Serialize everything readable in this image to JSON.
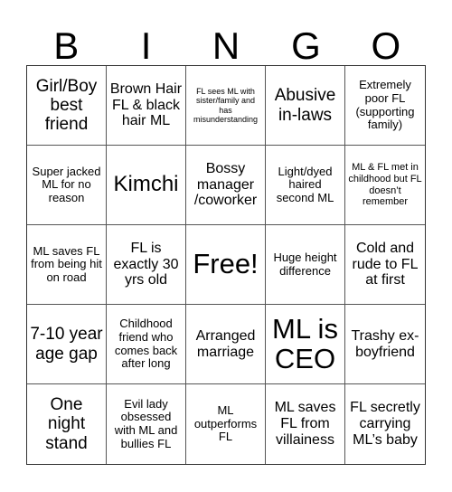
{
  "header": {
    "letters": [
      "B",
      "I",
      "N",
      "G",
      "O"
    ]
  },
  "board": {
    "rows": [
      [
        {
          "text": "Girl/Boy best friend"
        },
        {
          "text": "Brown Hair FL & black hair ML"
        },
        {
          "text": "FL sees ML with sister/family and has misunderstanding"
        },
        {
          "text": "Abusive in-laws"
        },
        {
          "text": "Extremely poor FL (supporting family)"
        }
      ],
      [
        {
          "text": "Super jacked ML for no reason"
        },
        {
          "text": "Kimchi"
        },
        {
          "text": "Bossy manager /coworker"
        },
        {
          "text": "Light/dyed haired second ML"
        },
        {
          "text": "ML & FL met in childhood but FL doesn’t remember"
        }
      ],
      [
        {
          "text": "ML saves FL from being hit on road"
        },
        {
          "text": "FL is exactly 30 yrs old"
        },
        {
          "text": "Free!"
        },
        {
          "text": "Huge height difference"
        },
        {
          "text": "Cold and rude to FL at first"
        }
      ],
      [
        {
          "text": "7-10 year age gap"
        },
        {
          "text": "Childhood friend who comes back after long"
        },
        {
          "text": "Arranged marriage"
        },
        {
          "text": "ML is CEO"
        },
        {
          "text": "Trashy ex-boyfriend"
        }
      ],
      [
        {
          "text": "One night stand"
        },
        {
          "text": "Evil lady obsessed with ML and bullies FL"
        },
        {
          "text": "ML outperforms FL"
        },
        {
          "text": "ML saves FL from villainess"
        },
        {
          "text": "FL secretly carrying ML’s baby"
        }
      ]
    ]
  }
}
